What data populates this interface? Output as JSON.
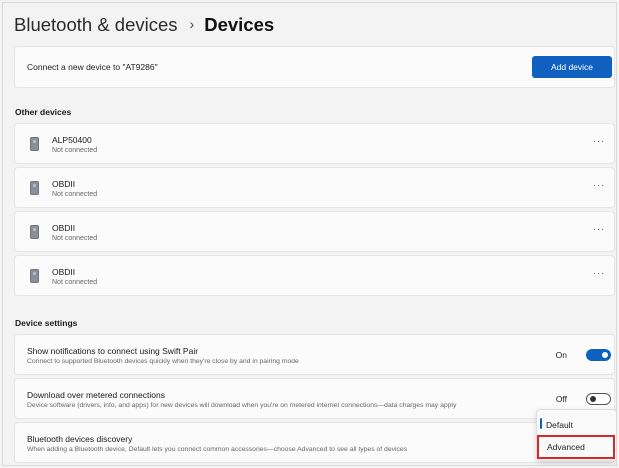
{
  "breadcrumb": {
    "parent": "Bluetooth & devices",
    "separator": "›",
    "current": "Devices"
  },
  "connect": {
    "text": "Connect a new device to \"AT9286\"",
    "button_label": "Add device"
  },
  "other_devices": {
    "title": "Other devices",
    "items": [
      {
        "name": "ALP50400",
        "status": "Not connected",
        "more": "···"
      },
      {
        "name": "OBDII",
        "status": "Not connected",
        "more": "···"
      },
      {
        "name": "OBDII",
        "status": "Not connected",
        "more": "···"
      },
      {
        "name": "OBDII",
        "status": "Not connected",
        "more": "···"
      }
    ]
  },
  "device_settings": {
    "title": "Device settings",
    "swift_pair": {
      "title": "Show notifications to connect using Swift Pair",
      "description": "Connect to supported Bluetooth devices quickly when they're close by and in pairing mode",
      "state": "On"
    },
    "metered": {
      "title": "Download over metered connections",
      "description": "Device software (drivers, info, and apps) for new devices will download when you're on metered internet connections—data charges may apply",
      "state": "Off"
    },
    "discovery": {
      "title": "Bluetooth devices discovery",
      "description": "When adding a Bluetooth device, Default lets you connect common accessories—choose Advanced to see all types of devices",
      "options": [
        "Default",
        "Advanced"
      ]
    }
  },
  "colors": {
    "accent": "#1060c0",
    "highlight": "#d22b2b"
  }
}
